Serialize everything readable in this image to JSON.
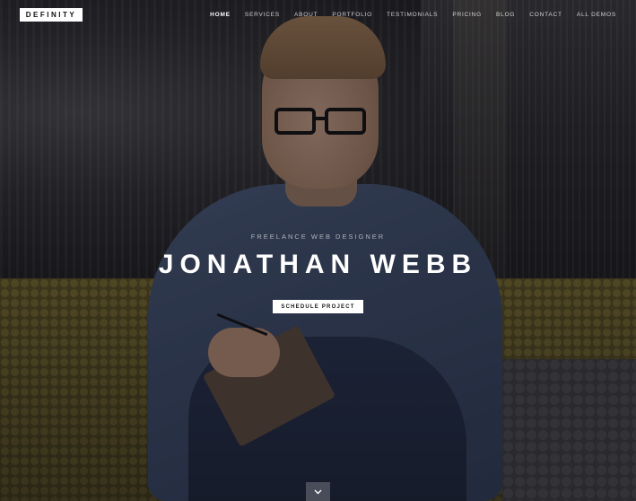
{
  "brand": {
    "logo_text": "DEFINITY"
  },
  "nav": {
    "items": [
      {
        "label": "HOME",
        "active": true
      },
      {
        "label": "SERVICES",
        "active": false
      },
      {
        "label": "ABOUT",
        "active": false
      },
      {
        "label": "PORTFOLIO",
        "active": false
      },
      {
        "label": "TESTIMONIALS",
        "active": false
      },
      {
        "label": "PRICING",
        "active": false
      },
      {
        "label": "BLOG",
        "active": false
      },
      {
        "label": "CONTACT",
        "active": false
      },
      {
        "label": "ALL DEMOS",
        "active": false
      }
    ]
  },
  "hero": {
    "subtitle": "FREELANCE WEB DESIGNER",
    "headline": "JONATHAN WEBB",
    "cta_label": "SCHEDULE PROJECT",
    "background_image": "person-on-sofa-with-notebook-photo",
    "scroll_icon": "chevron-down-icon"
  },
  "colors": {
    "overlay": "#0c0e14",
    "text": "#ffffff",
    "button_bg": "#ffffff",
    "button_text": "#1a1a1a"
  }
}
